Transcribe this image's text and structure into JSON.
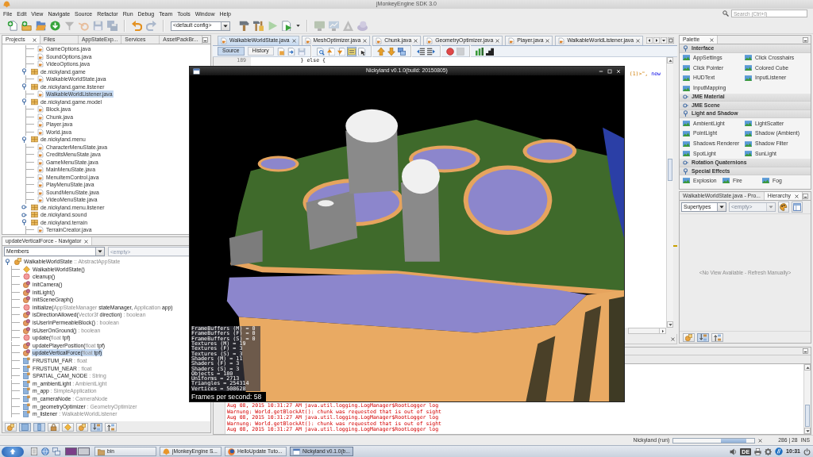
{
  "window": {
    "title": "jMonkeyEngine SDK 3.0"
  },
  "menu": [
    "File",
    "Edit",
    "View",
    "Navigate",
    "Source",
    "Refactor",
    "Run",
    "Debug",
    "Team",
    "Tools",
    "Window",
    "Help"
  ],
  "search": {
    "placeholder": "Search (Ctrl+I)"
  },
  "toolbar": {
    "left_buttons": [
      {
        "disabled": false
      },
      {
        "disabled": false
      },
      {
        "disabled": false
      },
      {
        "disabled": false
      },
      {
        "disabled": true
      },
      {
        "disabled": true
      },
      {
        "disabled": true
      },
      {
        "disabled": true
      },
      {
        "disabled": false
      },
      {
        "disabled": true
      }
    ],
    "config": "<default config>",
    "right_buttons": [
      {
        "disabled": false
      },
      {
        "disabled": false
      },
      {
        "disabled": true
      },
      {
        "disabled": false
      },
      {
        "disabled": true
      },
      {
        "disabled": true
      },
      {
        "disabled": true
      },
      {
        "disabled": true
      }
    ]
  },
  "projects": {
    "tabs": [
      {
        "label": "Projects",
        "selected": true
      },
      {
        "label": "Files",
        "selected": false
      },
      {
        "label": "AppStateExp...",
        "selected": false
      },
      {
        "label": "Services",
        "selected": false
      },
      {
        "label": "AssetPackBr...",
        "selected": false
      }
    ],
    "tree": [
      {
        "children": [
          {
            "kind": "file",
            "label": "GameOptions.java",
            "selected": false
          },
          {
            "kind": "file",
            "label": "SoundOptions.java",
            "selected": false
          },
          {
            "kind": "file",
            "label": "VideoOptions.java",
            "selected": false
          }
        ]
      },
      {
        "kind": "package",
        "label": "de.nickyland.game",
        "expanded": true,
        "selected": false,
        "children": [
          {
            "kind": "file",
            "label": "WalkableWorldState.java",
            "selected": false
          }
        ]
      },
      {
        "kind": "package",
        "label": "de.nickyland.game.listener",
        "expanded": true,
        "selected": false,
        "children": [
          {
            "kind": "file",
            "label": "WalkableWorldListener.java",
            "selected": true
          }
        ]
      },
      {
        "kind": "package",
        "label": "de.nickyland.game.model",
        "expanded": true,
        "selected": false,
        "children": [
          {
            "kind": "file",
            "label": "Block.java",
            "selected": false
          },
          {
            "kind": "file",
            "label": "Chunk.java",
            "selected": false
          },
          {
            "kind": "file",
            "label": "Player.java",
            "selected": false
          },
          {
            "kind": "file",
            "label": "World.java",
            "selected": false
          }
        ]
      },
      {
        "kind": "package",
        "label": "de.nickyland.menu",
        "expanded": true,
        "selected": false,
        "children": [
          {
            "kind": "file",
            "label": "CharacterMenuState.java",
            "selected": false
          },
          {
            "kind": "file",
            "label": "CreditsMenuState.java",
            "selected": false
          },
          {
            "kind": "file",
            "label": "GameMenuState.java",
            "selected": false
          },
          {
            "kind": "file",
            "label": "MainMenuState.java",
            "selected": false
          },
          {
            "kind": "file",
            "label": "MenuItemControl.java",
            "selected": false
          },
          {
            "kind": "file",
            "label": "PlayMenuState.java",
            "selected": false
          },
          {
            "kind": "file",
            "label": "SoundMenuState.java",
            "selected": false
          },
          {
            "kind": "file",
            "label": "VideoMenuState.java",
            "selected": false
          }
        ]
      },
      {
        "kind": "package",
        "label": "de.nickyland.menu.listener",
        "expanded": false,
        "selected": false
      },
      {
        "kind": "package",
        "label": "de.nickyland.sound",
        "expanded": false,
        "selected": false
      },
      {
        "kind": "package",
        "label": "de.nickyland.terrain",
        "expanded": true,
        "selected": false,
        "children": [
          {
            "kind": "file",
            "label": "TerrainCreator.java",
            "selected": false
          }
        ]
      }
    ]
  },
  "navigator": {
    "title": "updateVerticalForce - Navigator",
    "filter": "Members",
    "search": {
      "placeholder": "<empty>"
    },
    "root": {
      "kind": "class",
      "expanded": true,
      "selected": false,
      "parts": [
        {
          "text": "WalkableWorldState",
          "kind": "name"
        },
        {
          "text": " :: AbstractAppState",
          "kind": "type"
        }
      ],
      "children": [
        {
          "kind": "constructor",
          "selected": false,
          "parts": [
            {
              "text": "WalkableWorldState()",
              "kind": "name"
            }
          ]
        },
        {
          "kind": "method",
          "selected": false,
          "parts": [
            {
              "text": "cleanup()",
              "kind": "name"
            }
          ]
        },
        {
          "kind": "private-method",
          "selected": false,
          "parts": [
            {
              "text": "initCamera()",
              "kind": "name"
            }
          ]
        },
        {
          "kind": "private-method",
          "selected": false,
          "parts": [
            {
              "text": "initLight()",
              "kind": "name"
            }
          ]
        },
        {
          "kind": "private-method",
          "selected": false,
          "parts": [
            {
              "text": "initSceneGraph()",
              "kind": "name"
            }
          ]
        },
        {
          "kind": "method",
          "selected": false,
          "parts": [
            {
              "text": "initialize(",
              "kind": "name"
            },
            {
              "text": "AppStateManager",
              "kind": "type"
            },
            {
              "text": " stateManager, ",
              "kind": "name"
            },
            {
              "text": "Application",
              "kind": "type"
            },
            {
              "text": " app)",
              "kind": "name"
            }
          ]
        },
        {
          "kind": "private-method",
          "selected": false,
          "parts": [
            {
              "text": "isDirectionAllowed(",
              "kind": "name"
            },
            {
              "text": "Vector3f",
              "kind": "type"
            },
            {
              "text": " direction)",
              "kind": "name"
            },
            {
              "text": " : boolean",
              "kind": "type"
            }
          ]
        },
        {
          "kind": "private-method",
          "selected": false,
          "parts": [
            {
              "text": "isUserInPermeableBlock()",
              "kind": "name"
            },
            {
              "text": " : boolean",
              "kind": "type"
            }
          ]
        },
        {
          "kind": "private-method",
          "selected": false,
          "parts": [
            {
              "text": "isUserOnGround()",
              "kind": "name"
            },
            {
              "text": " : boolean",
              "kind": "type"
            }
          ]
        },
        {
          "kind": "method",
          "selected": false,
          "parts": [
            {
              "text": "update(",
              "kind": "name"
            },
            {
              "text": "float",
              "kind": "type"
            },
            {
              "text": " tpf)",
              "kind": "name"
            }
          ]
        },
        {
          "kind": "private-method",
          "selected": false,
          "parts": [
            {
              "text": "updatePlayerPosition(",
              "kind": "name"
            },
            {
              "text": "float",
              "kind": "type"
            },
            {
              "text": " tpf)",
              "kind": "name"
            }
          ]
        },
        {
          "kind": "private-method",
          "selected": true,
          "parts": [
            {
              "text": "updateVerticalForce(",
              "kind": "name"
            },
            {
              "text": "float",
              "kind": "type"
            },
            {
              "text": " tpf)",
              "kind": "name"
            }
          ]
        },
        {
          "kind": "field",
          "selected": false,
          "parts": [
            {
              "text": "FRUSTUM_FAR",
              "kind": "name"
            },
            {
              "text": " : float",
              "kind": "type"
            }
          ]
        },
        {
          "kind": "field",
          "selected": false,
          "parts": [
            {
              "text": "FRUSTUM_NEAR",
              "kind": "name"
            },
            {
              "text": " : float",
              "kind": "type"
            }
          ]
        },
        {
          "kind": "field",
          "selected": false,
          "parts": [
            {
              "text": "SPATIAL_CAM_NODE",
              "kind": "name"
            },
            {
              "text": " : String",
              "kind": "type"
            }
          ]
        },
        {
          "kind": "field",
          "selected": false,
          "parts": [
            {
              "text": "m_ambientLight",
              "kind": "name"
            },
            {
              "text": " : AmbientLight",
              "kind": "type"
            }
          ]
        },
        {
          "kind": "field",
          "selected": false,
          "parts": [
            {
              "text": "m_app",
              "kind": "name"
            },
            {
              "text": " : SimpleApplication",
              "kind": "type"
            }
          ]
        },
        {
          "kind": "field",
          "selected": false,
          "parts": [
            {
              "text": "m_cameraNode",
              "kind": "name"
            },
            {
              "text": " : CameraNode",
              "kind": "type"
            }
          ]
        },
        {
          "kind": "field",
          "selected": false,
          "parts": [
            {
              "text": "m_geometryOptimizer",
              "kind": "name"
            },
            {
              "text": " : GeometryOptimizer",
              "kind": "type"
            }
          ]
        },
        {
          "kind": "field",
          "selected": false,
          "parts": [
            {
              "text": "m_listener",
              "kind": "name"
            },
            {
              "text": " : WalkableWorldListener",
              "kind": "type"
            }
          ]
        }
      ]
    },
    "tools": [
      {
        "on": false
      },
      {
        "on": true
      },
      {
        "on": true
      },
      {
        "on": false
      },
      {
        "on": false
      },
      {
        "on": false
      },
      {
        "on": true
      },
      {
        "on": false
      }
    ]
  },
  "editor": {
    "tabs": [
      {
        "label": "WalkableWorldState.java",
        "selected": true
      },
      {
        "label": "MeshOptimizer.java",
        "selected": false
      },
      {
        "label": "Chunk.java",
        "selected": false
      },
      {
        "label": "GeometryOptimizer.java",
        "selected": false
      },
      {
        "label": "Player.java",
        "selected": false
      },
      {
        "label": "WalkableWorldListener.java",
        "selected": false
      }
    ],
    "views": [
      {
        "label": "Source",
        "selected": true
      },
      {
        "label": "History",
        "selected": false
      }
    ],
    "tools": [
      {
        "on": false,
        "disabled": false
      },
      {
        "on": false,
        "disabled": false
      },
      {
        "on": false,
        "disabled": true
      },
      {
        "on": false,
        "disabled": false
      },
      {
        "on": false,
        "disabled": false
      },
      {
        "on": false,
        "disabled": false
      },
      {
        "on": true,
        "disabled": false
      },
      {
        "on": false,
        "disabled": false
      },
      {
        "on": false,
        "disabled": false
      },
      {
        "on": false,
        "disabled": false
      },
      {
        "on": false,
        "disabled": false
      },
      {
        "on": false,
        "disabled": false
      },
      {
        "on": false,
        "disabled": false
      },
      {
        "on": false,
        "disabled": false
      },
      {
        "on": false,
        "disabled": true
      },
      {
        "on": false,
        "disabled": false
      },
      {
        "on": false,
        "disabled": false
      }
    ],
    "lines": [
      {
        "number": "189",
        "tokens": [
          {
            "text": "                } else {",
            "kind": "plain"
          }
        ]
      },
      {
        "tokens": [
          {
            "text": "(1)>\",",
            "kind": "string"
          },
          {
            "text": "new",
            "kind": "keyword"
          }
        ]
      }
    ]
  },
  "game_window": {
    "title": "Nickyland v0.1.0(build: 20150805)",
    "stats": [
      "FrameBuffers (M) = 0",
      "FrameBuffers (F) = 0",
      "FrameBuffers (S) = 0",
      "Textures (M) = 19",
      "Textures (F) = 3",
      "Textures (S) = 3",
      "Shaders (M) = 11",
      "Shaders (F) = 3",
      "Shaders (S) = 3",
      "Objects = 180",
      "Uniforms = 2713",
      "Triangles = 254314",
      "Vertices = 508628"
    ],
    "fps": "Frames per second: 58"
  },
  "output": {
    "lines": [
      "Aug 08, 2015 10:31:27 AM java.util.logging.LogManager$RootLogger log",
      "Warnung: World.getBlockAt(): chunk was requested that is out of sight",
      "Aug 08, 2015 10:31:27 AM java.util.logging.LogManager$RootLogger log",
      "Warnung: World.getBlockAt(): chunk was requested that is out of sight",
      "Aug 08, 2015 10:31:27 AM java.util.logging.LogManager$RootLogger log"
    ]
  },
  "palette": {
    "title": "Palette",
    "categories": [
      {
        "name": "Interface",
        "expanded": true,
        "items": [
          "AppSettings",
          "Click Crosshairs",
          "Click Pointer",
          "Colored Cube",
          "HUDText",
          "InputListener",
          "InputMapping"
        ]
      },
      {
        "name": "JME Material",
        "expanded": false
      },
      {
        "name": "JME Scene",
        "expanded": false
      },
      {
        "name": "Light and Shadow",
        "expanded": true,
        "items": [
          "AmbientLight",
          "LightScatter",
          "PointLight",
          "Shadow (Ambient)",
          "Shadows Renderer",
          "Shadow Filter",
          "SpotLight",
          "SunLight"
        ]
      },
      {
        "name": "Rotation Quaternions",
        "expanded": false
      },
      {
        "name": "Special Effects",
        "expanded": true,
        "items": [
          "Explosion",
          "Fire",
          "Fog"
        ]
      }
    ]
  },
  "hierarchy": {
    "tabs": [
      {
        "label": "WalkableWorldState.java - Pro...",
        "selected": false
      },
      {
        "label": "Hierarchy",
        "selected": true
      }
    ],
    "mode": "Supertypes",
    "filter": {
      "placeholder": "<empty>",
      "disabled": true
    },
    "message": "<No View Available - Refresh Manually>",
    "tools": [
      {
        "on": false
      },
      {
        "on": true
      },
      {
        "on": false
      }
    ]
  },
  "status_bar": {
    "task": "Nickyland (run)",
    "busy": true,
    "position": "286 | 28",
    "mode": "INS"
  },
  "taskbar": {
    "workspaces": [
      {
        "selected": true
      },
      {
        "selected": false
      }
    ],
    "tasks": [
      {
        "kind": "folder",
        "label": "bin",
        "selected": false
      },
      {
        "kind": "ide",
        "label": "jMonkeyEngine S...",
        "selected": false
      },
      {
        "kind": "browser",
        "label": "HelloUpdate Tuto...",
        "selected": false
      },
      {
        "kind": "window",
        "label": "Nickyland v0.1.0(b...",
        "selected": true
      }
    ],
    "keyboard": "DE",
    "clock": "10:31"
  }
}
